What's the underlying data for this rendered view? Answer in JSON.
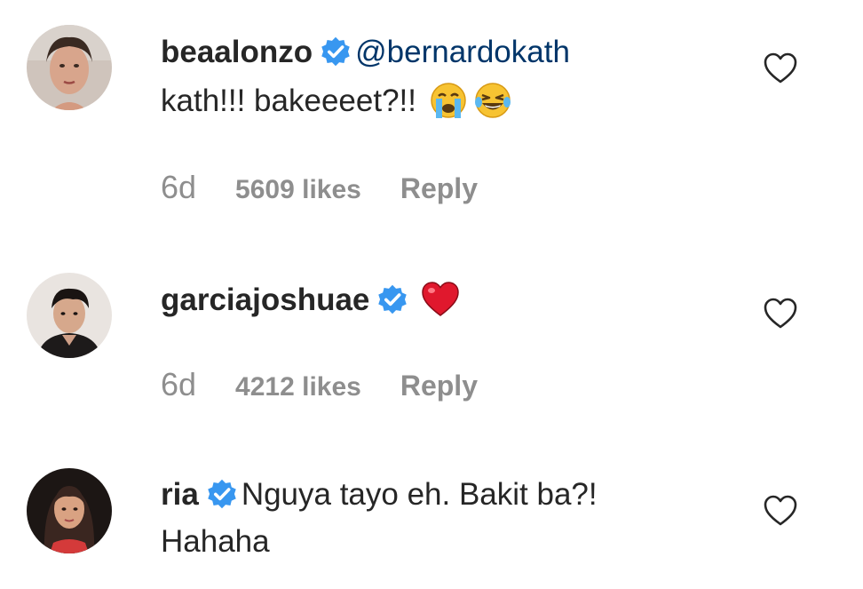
{
  "comments": [
    {
      "username": "beaalonzo",
      "mention": "@bernardokath",
      "text": "kath!!! bakeeeet?!!",
      "emojis": [
        "crying-face-emoji",
        "tears-of-joy-emoji"
      ],
      "time": "6d",
      "likes": "5609 likes",
      "reply_label": "Reply"
    },
    {
      "username": "garciajoshuae",
      "text": "",
      "emojis": [
        "red-heart-emoji"
      ],
      "time": "6d",
      "likes": "4212 likes",
      "reply_label": "Reply"
    },
    {
      "username": "ria",
      "text": "Nguya tayo eh. Bakit ba?!",
      "text_line2": "Hahaha"
    }
  ],
  "colors": {
    "verified_badge": "#3897f0",
    "mention": "#003569",
    "meta_text": "#8e8e8e",
    "heart_emoji": "#e0182d"
  },
  "icons": {
    "verified": "verified-badge-icon",
    "like": "heart-outline-icon"
  }
}
